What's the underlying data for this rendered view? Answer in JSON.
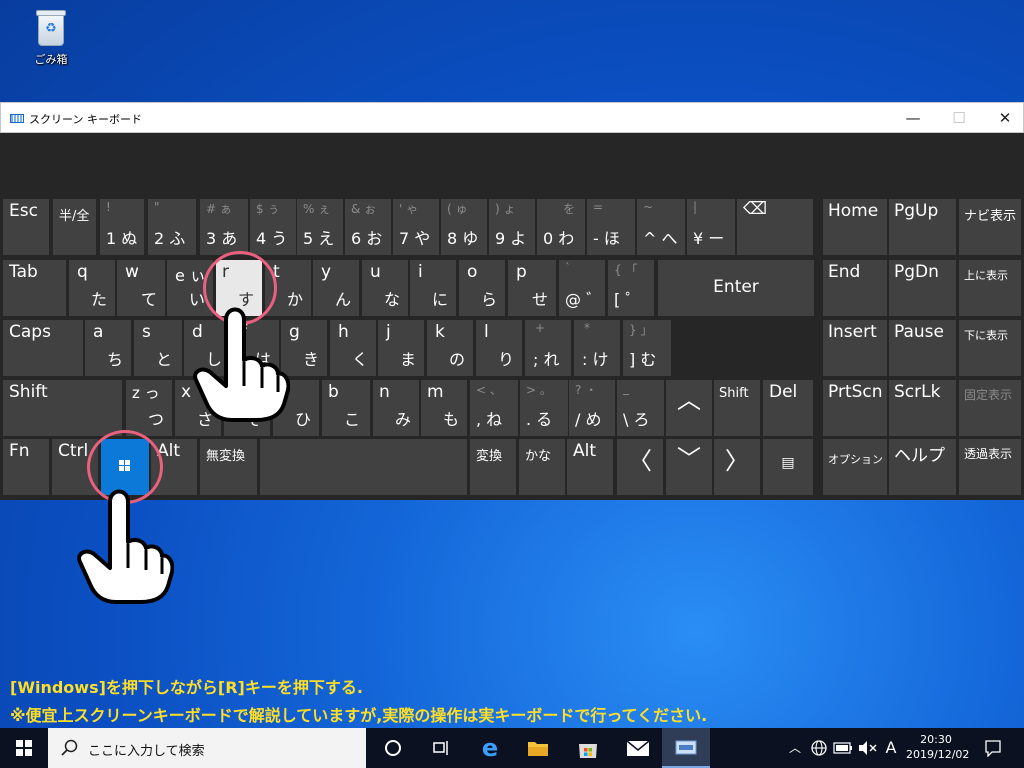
{
  "desktop": {
    "recycle_bin_label": "ごみ箱"
  },
  "window": {
    "title": "スクリーン キーボード",
    "minimize": "—",
    "maximize": "☐",
    "close": "✕"
  },
  "keys": {
    "esc": "Esc",
    "hankaku": "半/全",
    "n1_top": "!",
    "n1": "1 ぬ",
    "n2_top": "\"",
    "n2": "2 ふ",
    "n3_top": "# ぁ",
    "n3": "3 あ",
    "n4_top": "$ ぅ",
    "n4": "4 う",
    "n5_top": "% ぇ",
    "n5": "5 え",
    "n6_top": "& ぉ",
    "n6": "6 お",
    "n7_top": "' ゃ",
    "n7": "7 や",
    "n8_top": "( ゅ",
    "n8": "8 ゆ",
    "n9_top": ") ょ",
    "n9": "9 よ",
    "n0_top": "を",
    "n0": "0 わ",
    "minus_top": "=",
    "minus": "- ほ",
    "caret_top": "~",
    "caret": "^ へ",
    "yen_top": "|",
    "yen": "¥ ー",
    "backspace": "⌫",
    "tab": "Tab",
    "q": "q",
    "q_kana": "た",
    "w": "w",
    "w_kana": "て",
    "e": "e ぃ",
    "e_kana": "い",
    "r": "r",
    "r_kana": "す",
    "t": "t",
    "t_kana": "か",
    "y": "y",
    "y_kana": "ん",
    "u": "u",
    "u_kana": "な",
    "i": "i",
    "i_kana": "に",
    "o": "o",
    "o_kana": "ら",
    "p": "p",
    "p_kana": "せ",
    "at_top": "`",
    "at": "@ ゛",
    "bracket_top": "{ 「",
    "bracket": "[ ゜",
    "enter": "Enter",
    "caps": "Caps",
    "a": "a",
    "a_kana": "ち",
    "s": "s",
    "s_kana": "と",
    "d": "d",
    "d_kana": "し",
    "f": "f",
    "f_kana": "は",
    "g": "g",
    "g_kana": "き",
    "h": "h",
    "h_kana": "く",
    "j": "j",
    "j_kana": "ま",
    "k": "k",
    "k_kana": "の",
    "l": "l",
    "l_kana": "り",
    "semi_top": "+",
    "semi": "; れ",
    "colon_top": "*",
    "colon": ": け",
    "rbracket_top": "} 」",
    "rbracket": "] む",
    "shift": "Shift",
    "z": "z っ",
    "z_kana": "つ",
    "x": "x",
    "x_kana": "さ",
    "c": "c",
    "c_kana": "そ",
    "v": "v",
    "v_kana": "ひ",
    "b": "b",
    "b_kana": "こ",
    "n": "n",
    "n_kana": "み",
    "m": "m",
    "m_kana": "も",
    "comma_top": "< 、",
    "comma": ", ね",
    "period_top": "> 。",
    "period": ". る",
    "slash_top": "? ・",
    "slash": "/ め",
    "bslash_top": "_",
    "bslash": "\\ ろ",
    "up": "︿",
    "rshift": "Shift",
    "del": "Del",
    "fn": "Fn",
    "ctrl": "Ctrl",
    "alt": "Alt",
    "muhenkan": "無変換",
    "henkan": "変換",
    "kana": "かな",
    "ralt": "Alt",
    "left": "〈",
    "down": "﹀",
    "right": "〉",
    "menu": "▤",
    "home": "Home",
    "pgup": "PgUp",
    "nav": "ナビ表示",
    "end": "End",
    "pgdn": "PgDn",
    "moveup": "上に表示",
    "insert": "Insert",
    "pause": "Pause",
    "movedown": "下に表示",
    "prtscn": "PrtScn",
    "scrlk": "ScrLk",
    "dock": "固定表示",
    "options": "オプション",
    "help": "ヘルプ",
    "fade": "透過表示"
  },
  "caption": {
    "line1": "[Windows]を押下しながら[R]キーを押下する.",
    "line2": "※便宜上スクリーンキーボードで解説していますが,実際の操作は実キーボードで行ってください."
  },
  "taskbar": {
    "search_placeholder": "ここに入力して検索",
    "ime_mode": "A",
    "time": "20:30",
    "date": "2019/12/02"
  },
  "colors": {
    "highlight_ring": "#e9617d",
    "caption": "#ffde26",
    "win_key": "#0c79d8"
  }
}
